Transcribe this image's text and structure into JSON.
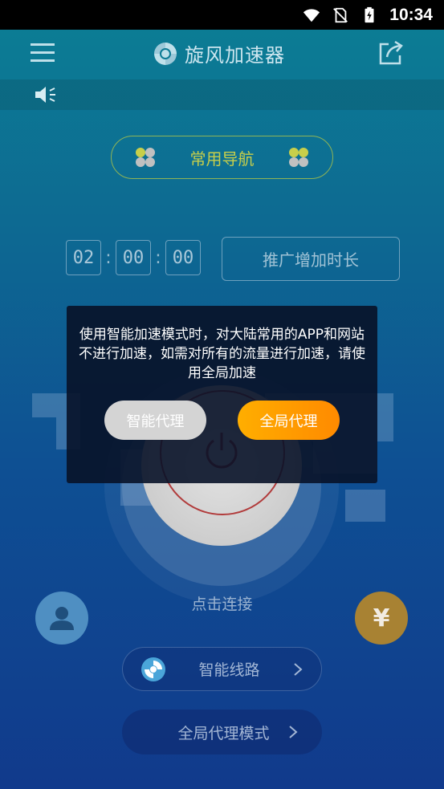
{
  "status_bar": {
    "time": "10:34"
  },
  "app_bar": {
    "title": "旋风加速器"
  },
  "nav": {
    "label": "常用导航"
  },
  "timer": {
    "hours": "02",
    "minutes": "00",
    "seconds": "00",
    "extend_label": "推广增加时长"
  },
  "main": {
    "connect_label": "点击连接"
  },
  "coin": {
    "symbol": "¥"
  },
  "route": {
    "label": "智能线路"
  },
  "mode": {
    "label": "全局代理模式"
  },
  "dialog": {
    "message": "使用智能加速模式时，对大陆常用的APP和网站不进行加速，如需对所有的流量进行加速，请使用全局加速",
    "smart_label": "智能代理",
    "global_label": "全局代理"
  },
  "colors": {
    "accent_orange": "#ff9a00",
    "nav_yellow": "#c8cf4a",
    "power_red": "#b13b3b",
    "coin_gold": "#a88233"
  },
  "icons": [
    "wifi-icon",
    "no-sim-icon",
    "battery-charging-icon",
    "menu-icon",
    "share-icon",
    "logo-icon",
    "speaker-icon",
    "clover-icon",
    "power-icon",
    "user-icon",
    "chevron-right-icon"
  ]
}
